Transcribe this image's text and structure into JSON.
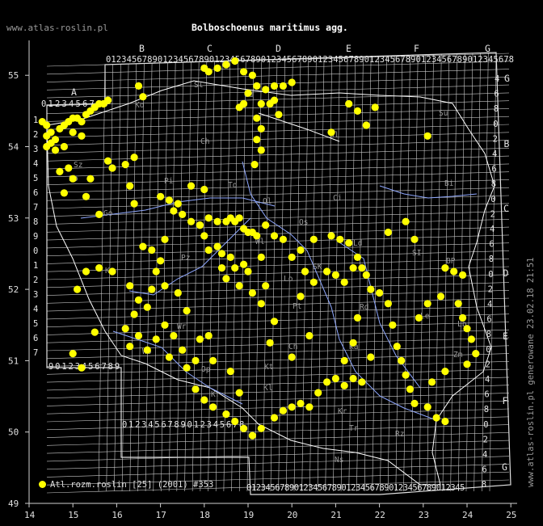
{
  "header": {
    "site": "www.atlas-roslin.pl",
    "title": "Bolboschoenus maritimus agg."
  },
  "side_note": "www.atlas-roslin.pl generowane 23.02.18 21:51",
  "legend": {
    "label": "Atl.rozm.roslin [25] (2001) #353",
    "color": "#ffff00"
  },
  "colors": {
    "background": "#000000",
    "grid": "#c8c8c8",
    "rivers": "#8fa8ff",
    "borders": "#ffffff",
    "points": "#ffff00"
  },
  "axes": {
    "lon_ticks": [
      "14",
      "15",
      "16",
      "17",
      "18",
      "19",
      "20",
      "21",
      "22",
      "23",
      "24",
      "25"
    ],
    "lat_ticks": [
      "49",
      "50",
      "51",
      "52",
      "53",
      "54",
      "55"
    ]
  },
  "grid_labels": {
    "top_zones": [
      "B",
      "C",
      "D",
      "E",
      "F",
      "G"
    ],
    "top_digits": "0123456789012345678901234567890123456789012345678901234567890123456789012345678",
    "left_zone": "A",
    "left_top_digits": "0123456789",
    "left_bottom_digits": "90123456789",
    "bottom_left_digits": "0123456789012345678",
    "bottom_digits": "0123456789012345678901234567890123456789012345",
    "left_zones": [
      "1",
      "2",
      "3",
      "4",
      "5",
      "6",
      "7",
      "8",
      "9",
      "0",
      "1",
      "2",
      "3",
      "4",
      "5",
      "6",
      "7"
    ],
    "right_zones": [
      "G",
      "B",
      "C",
      "D",
      "E",
      "F",
      "G"
    ],
    "right_digits": [
      "4",
      "6",
      "8",
      "0",
      "2",
      "4",
      "6",
      "8",
      "0",
      "2",
      "4",
      "6",
      "8",
      "0",
      "2",
      "4",
      "6",
      "8",
      "0",
      "2",
      "4",
      "6",
      "8",
      "0",
      "2",
      "4",
      "6",
      "8"
    ]
  },
  "region_labels": [
    "Ko",
    "Sl",
    "Gd",
    "Ol",
    "Su",
    "Bi",
    "Ch",
    "Pi",
    "Ol",
    "Ci",
    "Os",
    "To",
    "Wl",
    "Sz",
    "Go",
    "Pz",
    "Ko",
    "SI",
    "Lo",
    "SK",
    "Ld",
    "BP",
    "Rd",
    "Le",
    "Ka",
    "Pt",
    "Kt",
    "Lb",
    "Ch",
    "Wr",
    "Op",
    "Kl",
    "Kr",
    "Ns",
    "Tr",
    "Zm",
    "Rz",
    "Kr",
    "Wb",
    "Sb"
  ],
  "chart_data": {
    "type": "scatter",
    "title": "Bolboschoenus maritimus agg.",
    "xlabel": "",
    "ylabel": "",
    "xlim": [
      14,
      25
    ],
    "ylim": [
      49,
      55.5
    ],
    "grid": true,
    "legend_placement": "bottom-left",
    "series": [
      {
        "name": "Atl.rozm.roslin [25] (2001) #353",
        "points": [
          [
            14.3,
            54.35
          ],
          [
            14.4,
            54.3
          ],
          [
            14.5,
            54.2
          ],
          [
            14.4,
            54.15
          ],
          [
            14.5,
            54.05
          ],
          [
            14.4,
            54.0
          ],
          [
            14.6,
            54.1
          ],
          [
            14.7,
            54.25
          ],
          [
            14.8,
            54.3
          ],
          [
            14.9,
            54.35
          ],
          [
            15.0,
            54.4
          ],
          [
            15.1,
            54.4
          ],
          [
            15.2,
            54.35
          ],
          [
            15.3,
            54.45
          ],
          [
            15.4,
            54.5
          ],
          [
            15.5,
            54.55
          ],
          [
            15.6,
            54.6
          ],
          [
            15.7,
            54.6
          ],
          [
            15.8,
            54.65
          ],
          [
            14.6,
            53.95
          ],
          [
            14.8,
            54.0
          ],
          [
            15.0,
            54.2
          ],
          [
            15.2,
            54.15
          ],
          [
            14.7,
            53.65
          ],
          [
            14.9,
            53.7
          ],
          [
            15.0,
            53.55
          ],
          [
            14.8,
            53.35
          ],
          [
            15.4,
            53.55
          ],
          [
            15.3,
            53.3
          ],
          [
            15.6,
            53.05
          ],
          [
            15.8,
            53.8
          ],
          [
            15.9,
            53.7
          ],
          [
            16.2,
            53.75
          ],
          [
            16.4,
            53.85
          ],
          [
            16.3,
            53.45
          ],
          [
            16.6,
            54.7
          ],
          [
            16.5,
            54.85
          ],
          [
            18.0,
            55.1
          ],
          [
            18.1,
            55.05
          ],
          [
            18.3,
            55.1
          ],
          [
            18.5,
            55.15
          ],
          [
            18.7,
            55.2
          ],
          [
            18.9,
            55.05
          ],
          [
            19.1,
            55.0
          ],
          [
            18.8,
            54.55
          ],
          [
            18.9,
            54.6
          ],
          [
            19.0,
            54.75
          ],
          [
            19.2,
            54.85
          ],
          [
            19.4,
            54.8
          ],
          [
            19.6,
            54.85
          ],
          [
            19.8,
            54.85
          ],
          [
            20.0,
            54.9
          ],
          [
            19.3,
            54.6
          ],
          [
            19.5,
            54.6
          ],
          [
            19.6,
            54.65
          ],
          [
            19.7,
            54.45
          ],
          [
            19.2,
            54.4
          ],
          [
            19.3,
            54.25
          ],
          [
            19.2,
            54.1
          ],
          [
            19.3,
            53.95
          ],
          [
            19.15,
            53.75
          ],
          [
            20.9,
            54.2
          ],
          [
            21.3,
            54.6
          ],
          [
            21.5,
            54.5
          ],
          [
            21.7,
            54.3
          ],
          [
            21.9,
            54.55
          ],
          [
            23.1,
            54.15
          ],
          [
            16.4,
            53.2
          ],
          [
            17.0,
            53.3
          ],
          [
            17.2,
            53.25
          ],
          [
            17.4,
            53.2
          ],
          [
            17.3,
            53.1
          ],
          [
            17.5,
            53.05
          ],
          [
            17.7,
            52.95
          ],
          [
            17.9,
            52.9
          ],
          [
            18.1,
            53.0
          ],
          [
            18.3,
            52.95
          ],
          [
            18.5,
            52.95
          ],
          [
            18.6,
            53.0
          ],
          [
            18.7,
            52.95
          ],
          [
            18.8,
            53.0
          ],
          [
            18.9,
            52.85
          ],
          [
            19.0,
            52.8
          ],
          [
            19.1,
            52.8
          ],
          [
            19.2,
            52.75
          ],
          [
            19.4,
            52.9
          ],
          [
            19.6,
            52.75
          ],
          [
            19.8,
            52.7
          ],
          [
            17.9,
            52.9
          ],
          [
            18.0,
            52.75
          ],
          [
            18.1,
            52.55
          ],
          [
            18.3,
            52.6
          ],
          [
            18.4,
            52.5
          ],
          [
            18.6,
            52.45
          ],
          [
            18.4,
            52.3
          ],
          [
            18.7,
            52.3
          ],
          [
            18.9,
            52.35
          ],
          [
            19.0,
            52.25
          ],
          [
            18.5,
            52.15
          ],
          [
            18.8,
            52.05
          ],
          [
            16.9,
            52.25
          ],
          [
            17.0,
            52.4
          ],
          [
            16.8,
            52.55
          ],
          [
            17.1,
            52.7
          ],
          [
            16.6,
            52.6
          ],
          [
            16.8,
            52.0
          ],
          [
            16.7,
            51.75
          ],
          [
            16.4,
            51.65
          ],
          [
            16.2,
            51.45
          ],
          [
            16.5,
            51.35
          ],
          [
            16.3,
            51.2
          ],
          [
            16.7,
            51.15
          ],
          [
            16.9,
            51.3
          ],
          [
            17.1,
            51.5
          ],
          [
            17.3,
            51.35
          ],
          [
            17.5,
            51.15
          ],
          [
            17.6,
            50.9
          ],
          [
            17.8,
            51.0
          ],
          [
            17.2,
            51.05
          ],
          [
            19.1,
            51.95
          ],
          [
            19.4,
            52.05
          ],
          [
            19.3,
            51.8
          ],
          [
            19.6,
            51.55
          ],
          [
            19.5,
            51.25
          ],
          [
            20.0,
            51.05
          ],
          [
            20.3,
            52.25
          ],
          [
            20.5,
            52.1
          ],
          [
            20.8,
            52.25
          ],
          [
            21.0,
            52.2
          ],
          [
            21.2,
            52.1
          ],
          [
            21.4,
            52.3
          ],
          [
            21.6,
            52.3
          ],
          [
            21.7,
            52.2
          ],
          [
            21.8,
            52.0
          ],
          [
            22.0,
            51.95
          ],
          [
            21.5,
            51.6
          ],
          [
            21.4,
            51.25
          ],
          [
            21.2,
            51.0
          ],
          [
            22.2,
            51.8
          ],
          [
            22.3,
            51.5
          ],
          [
            22.4,
            51.2
          ],
          [
            22.5,
            51.0
          ],
          [
            22.6,
            50.8
          ],
          [
            22.7,
            50.6
          ],
          [
            22.8,
            50.4
          ],
          [
            23.1,
            50.35
          ],
          [
            23.3,
            50.2
          ],
          [
            23.5,
            50.15
          ],
          [
            22.9,
            51.6
          ],
          [
            23.1,
            51.8
          ],
          [
            23.4,
            51.9
          ],
          [
            23.5,
            52.3
          ],
          [
            23.7,
            52.25
          ],
          [
            23.9,
            52.2
          ],
          [
            23.8,
            51.8
          ],
          [
            23.9,
            51.6
          ],
          [
            24.0,
            51.45
          ],
          [
            24.1,
            51.3
          ],
          [
            24.2,
            51.1
          ],
          [
            24.0,
            50.95
          ],
          [
            23.5,
            50.85
          ],
          [
            23.2,
            50.7
          ],
          [
            17.8,
            50.6
          ],
          [
            18.0,
            50.45
          ],
          [
            18.2,
            50.35
          ],
          [
            18.5,
            50.25
          ],
          [
            18.7,
            50.15
          ],
          [
            18.9,
            50.05
          ],
          [
            19.1,
            49.95
          ],
          [
            19.3,
            50.05
          ],
          [
            19.6,
            50.2
          ],
          [
            19.8,
            50.3
          ],
          [
            20.0,
            50.35
          ],
          [
            20.2,
            50.4
          ],
          [
            20.4,
            50.35
          ],
          [
            20.6,
            50.55
          ],
          [
            20.8,
            50.7
          ],
          [
            21.0,
            50.75
          ],
          [
            21.2,
            50.65
          ],
          [
            21.4,
            50.75
          ],
          [
            21.6,
            50.7
          ],
          [
            18.6,
            50.85
          ],
          [
            18.2,
            51.0
          ],
          [
            17.9,
            51.3
          ],
          [
            17.6,
            51.7
          ],
          [
            17.4,
            51.95
          ],
          [
            17.1,
            52.05
          ],
          [
            16.5,
            51.85
          ],
          [
            16.3,
            52.05
          ],
          [
            15.9,
            52.25
          ],
          [
            15.6,
            52.3
          ],
          [
            15.3,
            52.25
          ],
          [
            15.1,
            52.0
          ],
          [
            15.5,
            51.4
          ],
          [
            15.0,
            51.1
          ],
          [
            15.2,
            50.9
          ],
          [
            18.1,
            51.35
          ],
          [
            18.8,
            50.55
          ],
          [
            18.0,
            53.4
          ],
          [
            17.7,
            53.45
          ],
          [
            19.3,
            52.45
          ],
          [
            20.2,
            52.55
          ],
          [
            20.5,
            52.7
          ],
          [
            20.9,
            52.75
          ],
          [
            21.1,
            52.7
          ],
          [
            21.3,
            52.65
          ],
          [
            21.5,
            52.45
          ],
          [
            22.2,
            52.8
          ],
          [
            22.6,
            52.95
          ],
          [
            22.8,
            52.7
          ],
          [
            20.0,
            52.45
          ],
          [
            20.2,
            51.9
          ],
          [
            20.4,
            51.35
          ],
          [
            21.8,
            51.05
          ]
        ]
      }
    ]
  }
}
